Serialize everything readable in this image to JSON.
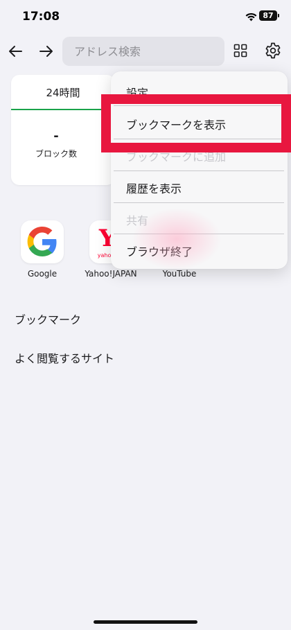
{
  "status": {
    "time": "17:08",
    "battery": "87"
  },
  "toolbar": {
    "address_placeholder": "アドレス検索"
  },
  "stats": {
    "tab_label": "24時間",
    "value": "-",
    "label": "ブロック数",
    "accent": "#19a34a"
  },
  "shortcuts": [
    {
      "label": "Google",
      "icon": "google-logo"
    },
    {
      "label": "Yahoo!JAPAN",
      "icon": "yahoo-logo",
      "logo_text": "Y",
      "logo_sub": "yahoo"
    },
    {
      "label": "YouTube",
      "icon": "youtube-logo"
    }
  ],
  "sections": {
    "bookmarks": "ブックマーク",
    "frequent": "よく閲覧するサイト"
  },
  "menu": {
    "items": [
      {
        "label": "設定",
        "enabled": true
      },
      {
        "label": "ブックマークを表示",
        "enabled": true
      },
      {
        "label": "ブックマークに追加",
        "enabled": false
      },
      {
        "label": "履歴を表示",
        "enabled": true
      },
      {
        "label": "共有",
        "enabled": false
      },
      {
        "label": "ブラウザ終了",
        "enabled": true
      }
    ]
  },
  "colors": {
    "highlight": "#e8173f",
    "background": "#f2f2f7"
  }
}
